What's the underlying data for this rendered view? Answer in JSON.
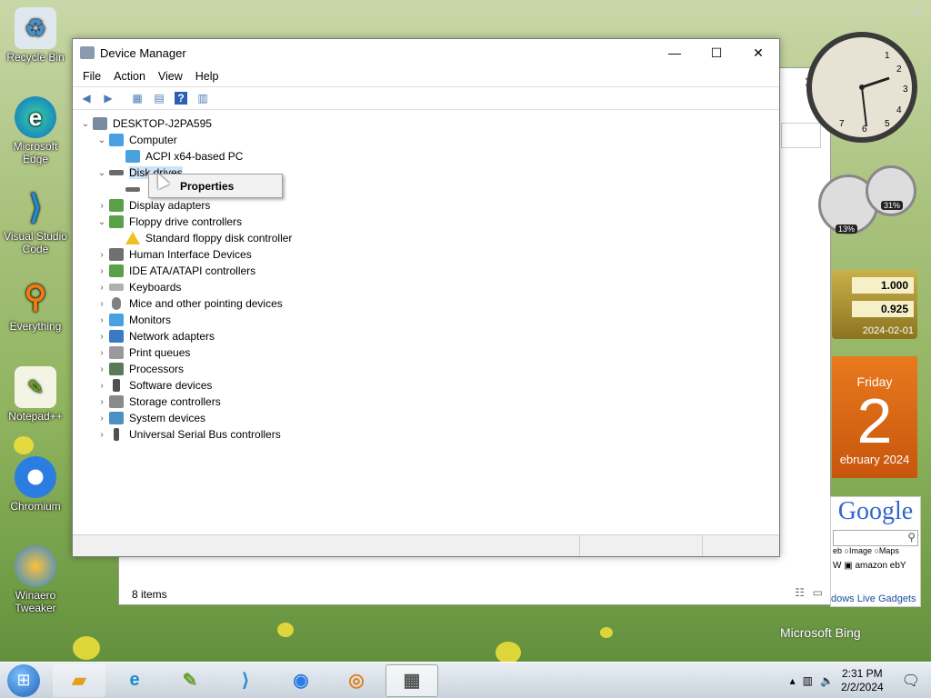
{
  "desktop": {
    "icons": [
      {
        "label": "Recycle Bin",
        "icon": "recycle-bin-icon"
      },
      {
        "label": "Microsoft\nEdge",
        "icon": "edge-icon"
      },
      {
        "label": "Visual Studio\nCode",
        "icon": "vscode-icon"
      },
      {
        "label": "Everything",
        "icon": "everything-icon"
      },
      {
        "label": "Notepad++",
        "icon": "notepadpp-icon"
      },
      {
        "label": "Chromium",
        "icon": "chromium-icon"
      },
      {
        "label": "Winaero\nTweaker",
        "icon": "winaero-icon"
      }
    ]
  },
  "background_window": {
    "status": "8 items"
  },
  "device_manager": {
    "title": "Device Manager",
    "menu": [
      "File",
      "Action",
      "View",
      "Help"
    ],
    "tree": {
      "root": "DESKTOP-J2PA595",
      "items": [
        {
          "label": "Computer",
          "expanded": true,
          "level": 1
        },
        {
          "label": "ACPI x64-based PC",
          "level": 2
        },
        {
          "label": "Disk drives",
          "expanded": true,
          "level": 1,
          "selected": true
        },
        {
          "label": "",
          "level": 2
        },
        {
          "label": "Display adapters",
          "level": 1
        },
        {
          "label": "Floppy drive controllers",
          "expanded": true,
          "level": 1
        },
        {
          "label": "Standard floppy disk controller",
          "level": 2,
          "warning": true
        },
        {
          "label": "Human Interface Devices",
          "level": 1
        },
        {
          "label": "IDE ATA/ATAPI controllers",
          "level": 1
        },
        {
          "label": "Keyboards",
          "level": 1
        },
        {
          "label": "Mice and other pointing devices",
          "level": 1
        },
        {
          "label": "Monitors",
          "level": 1
        },
        {
          "label": "Network adapters",
          "level": 1
        },
        {
          "label": "Print queues",
          "level": 1
        },
        {
          "label": "Processors",
          "level": 1
        },
        {
          "label": "Software devices",
          "level": 1
        },
        {
          "label": "Storage controllers",
          "level": 1
        },
        {
          "label": "System devices",
          "level": 1
        },
        {
          "label": "Universal Serial Bus controllers",
          "level": 1
        }
      ]
    },
    "context_menu": {
      "item": "Properties"
    }
  },
  "gadgets": {
    "gauge1": "13%",
    "gauge2": "31%",
    "currency": {
      "value1": "1.000",
      "value2": "0.925",
      "date": "2024-02-01"
    },
    "calendar": {
      "day": "Friday",
      "number": "2",
      "month": "ebruary 2024"
    },
    "google": {
      "logo": "Google",
      "opt_image": "Image",
      "opt_maps": "Maps",
      "opt_web": "eb",
      "footer": "dows Live Gadgets"
    },
    "bing": "Microsoft Bing"
  },
  "taskbar": {
    "time": "2:31 PM",
    "date": "2/2/2024"
  }
}
